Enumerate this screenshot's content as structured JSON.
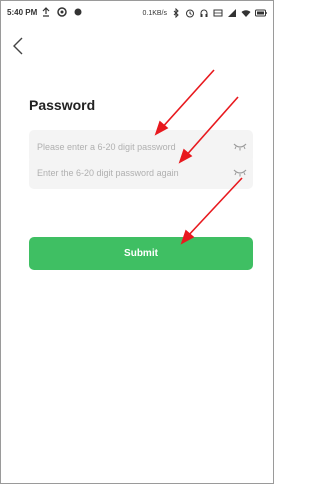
{
  "status_bar": {
    "time": "5:40 PM",
    "net_speed": "0.1KB/s",
    "icons_left": [
      "upload-icon",
      "vpn-icon",
      "location-icon"
    ],
    "icons_right": [
      "bluetooth-icon",
      "alarm-icon",
      "headset-icon",
      "screenshot-icon",
      "signal-icon",
      "wifi-icon",
      "battery-icon"
    ]
  },
  "nav": {
    "back_icon": "chevron-left-icon"
  },
  "form": {
    "title": "Password",
    "password": {
      "value": "",
      "placeholder": "Please enter a 6-20 digit password"
    },
    "password_again": {
      "value": "",
      "placeholder": "Enter the 6-20 digit password again"
    },
    "eye_icon": "eye-closed-icon",
    "submit_label": "Submit"
  },
  "annotations": {
    "arrow_color": "#e8191e"
  },
  "colors": {
    "accent": "#3fbf63",
    "field_bg": "#f4f4f4"
  }
}
